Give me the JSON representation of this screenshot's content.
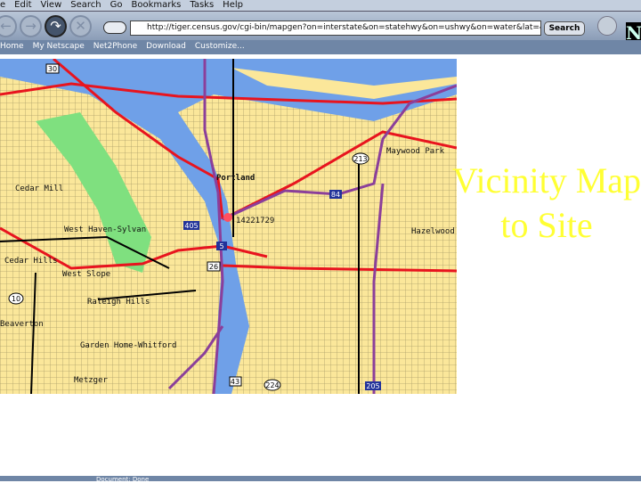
{
  "menu": [
    "e",
    "Edit",
    "View",
    "Search",
    "Go",
    "Bookmarks",
    "Tasks",
    "Help"
  ],
  "toolbar": {
    "url": "http://tiger.census.gov/cgi-bin/mapgen?on=interstate&on=statehwy&on=ushwy&on=water&lat=45.5",
    "search_label": "Search",
    "logo": "N"
  },
  "bookmarks": [
    "Home",
    "My Netscape",
    "Net2Phone",
    "Download",
    "Customize..."
  ],
  "map": {
    "places": [
      "Portland",
      "Cedar Mill",
      "West Haven-Sylvan",
      "Cedar Hills",
      "West Slope",
      "Raleigh Hills",
      "Garden Home-Whitford",
      "Metzger",
      "Maywood Park",
      "Hazelwood",
      "Beaverton",
      "14221729"
    ],
    "shields": [
      "30",
      "213",
      "84",
      "405",
      "5",
      "26",
      "10",
      "43",
      "224",
      "205"
    ]
  },
  "slide_title": "Vicinity Map to Site",
  "status": "Document: Done",
  "colors": {
    "land": "#fbe79a",
    "water": "#6fa0e8",
    "park": "#7fe07f",
    "highway": "#e8141e",
    "interstate": "#8b3f9a"
  }
}
